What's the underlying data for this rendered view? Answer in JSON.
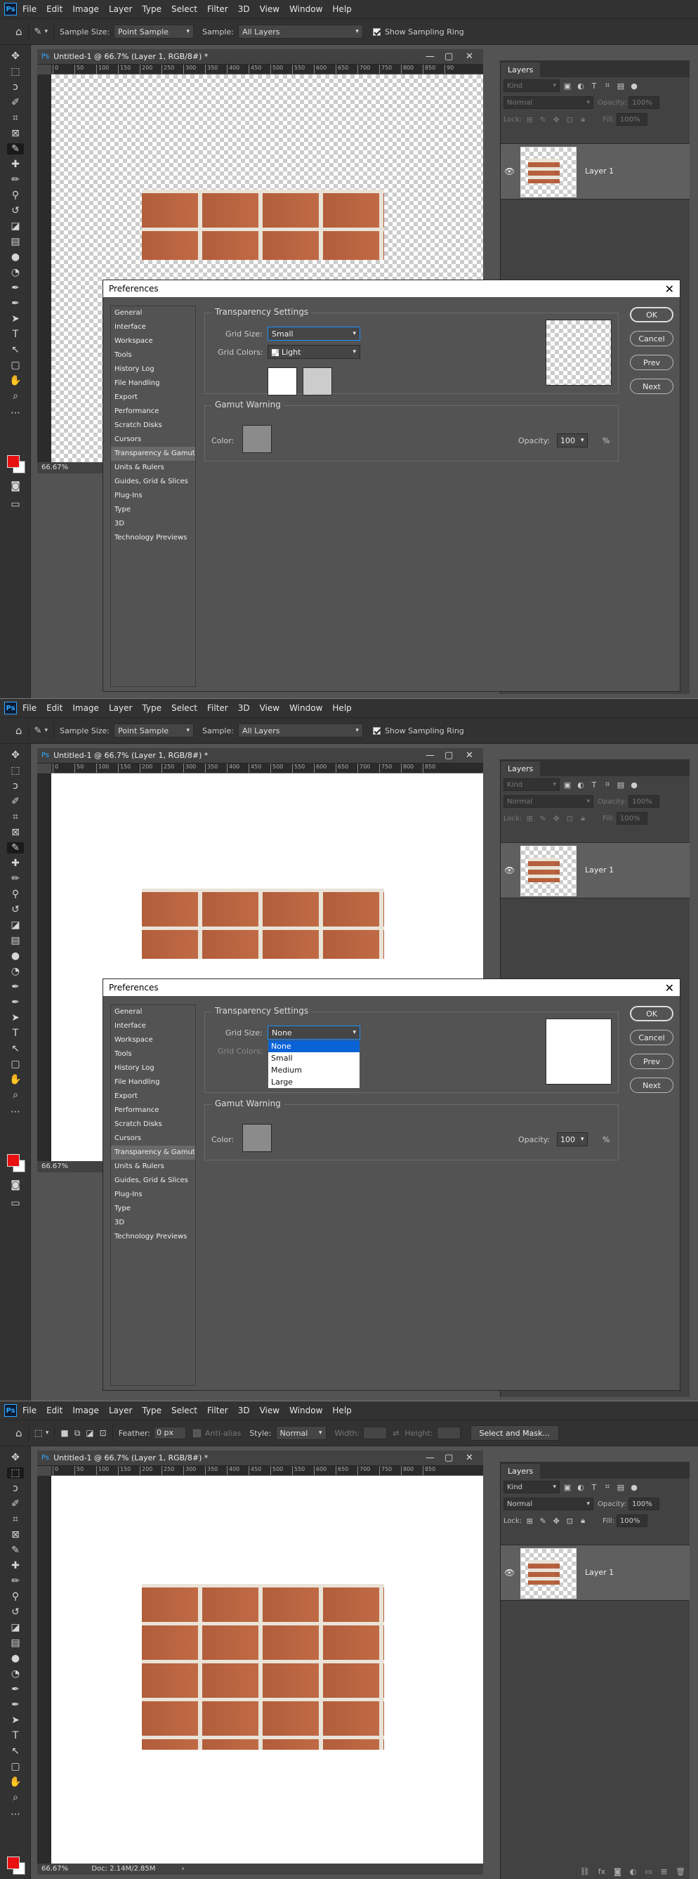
{
  "app": {
    "logo": "Ps",
    "menu": [
      "File",
      "Edit",
      "Image",
      "Layer",
      "Type",
      "Select",
      "Filter",
      "3D",
      "View",
      "Window",
      "Help"
    ]
  },
  "eyedropper_options": {
    "sample_size_label": "Sample Size:",
    "sample_size_value": "Point Sample",
    "sample_label": "Sample:",
    "sample_value": "All Layers",
    "show_ring_label": "Show Sampling Ring"
  },
  "marquee_options": {
    "feather_label": "Feather:",
    "feather_value": "0 px",
    "antialias_label": "Anti-alias",
    "style_label": "Style:",
    "style_value": "Normal",
    "width_label": "Width:",
    "height_label": "Height:",
    "select_mask": "Select and Mask..."
  },
  "document": {
    "title": "Untitled-1 @ 66.7% (Layer 1, RGB/8#) *",
    "zoom": "66.67%",
    "doc_info": "Doc: 2.14M/2.85M",
    "ruler_ticks": [
      "0",
      "50",
      "100",
      "150",
      "200",
      "250",
      "300",
      "350",
      "400",
      "450",
      "500",
      "550",
      "600",
      "650",
      "700",
      "750",
      "800",
      "850",
      "90"
    ]
  },
  "layers_panel": {
    "tab": "Layers",
    "kind": "Kind",
    "blend": "Normal",
    "opacity_label": "Opacity:",
    "opacity_value": "100%",
    "lock_label": "Lock:",
    "fill_label": "Fill:",
    "fill_value": "100%",
    "layer_name": "Layer 1"
  },
  "preferences": {
    "title": "Preferences",
    "nav": [
      "General",
      "Interface",
      "Workspace",
      "Tools",
      "History Log",
      "File Handling",
      "Export",
      "Performance",
      "Scratch Disks",
      "Cursors",
      "Transparency & Gamut",
      "Units & Rulers",
      "Guides, Grid & Slices",
      "Plug-Ins",
      "Type",
      "3D",
      "Technology Previews"
    ],
    "selected_nav": "Transparency & Gamut",
    "transparency_group": "Transparency Settings",
    "grid_size_label": "Grid Size:",
    "grid_size_value_1": "Small",
    "grid_size_value_2": "None",
    "grid_colors_label": "Grid Colors:",
    "grid_colors_value": "Light",
    "grid_size_options": [
      "None",
      "Small",
      "Medium",
      "Large"
    ],
    "gamut_group": "Gamut Warning",
    "color_label": "Color:",
    "opacity_label": "Opacity:",
    "opacity_value": "100",
    "percent": "%",
    "buttons": {
      "ok": "OK",
      "cancel": "Cancel",
      "prev": "Prev",
      "next": "Next"
    },
    "gamut_color": "#8b8b8b"
  },
  "colors": {
    "foreground": "#e81010",
    "background": "#ffffff",
    "accent": "#1a8fff"
  },
  "icons": [
    "home-icon",
    "eyedropper-icon",
    "move-icon",
    "marquee-icon",
    "lasso-icon",
    "quick-select-icon",
    "crop-icon",
    "frame-icon",
    "healing-icon",
    "brush-icon",
    "stamp-icon",
    "history-brush-icon",
    "eraser-icon",
    "gradient-icon",
    "blur-icon",
    "dodge-icon",
    "pen-icon",
    "type-icon",
    "path-select-icon",
    "rectangle-icon",
    "hand-icon",
    "zoom-icon",
    "eye-icon",
    "close-icon"
  ]
}
